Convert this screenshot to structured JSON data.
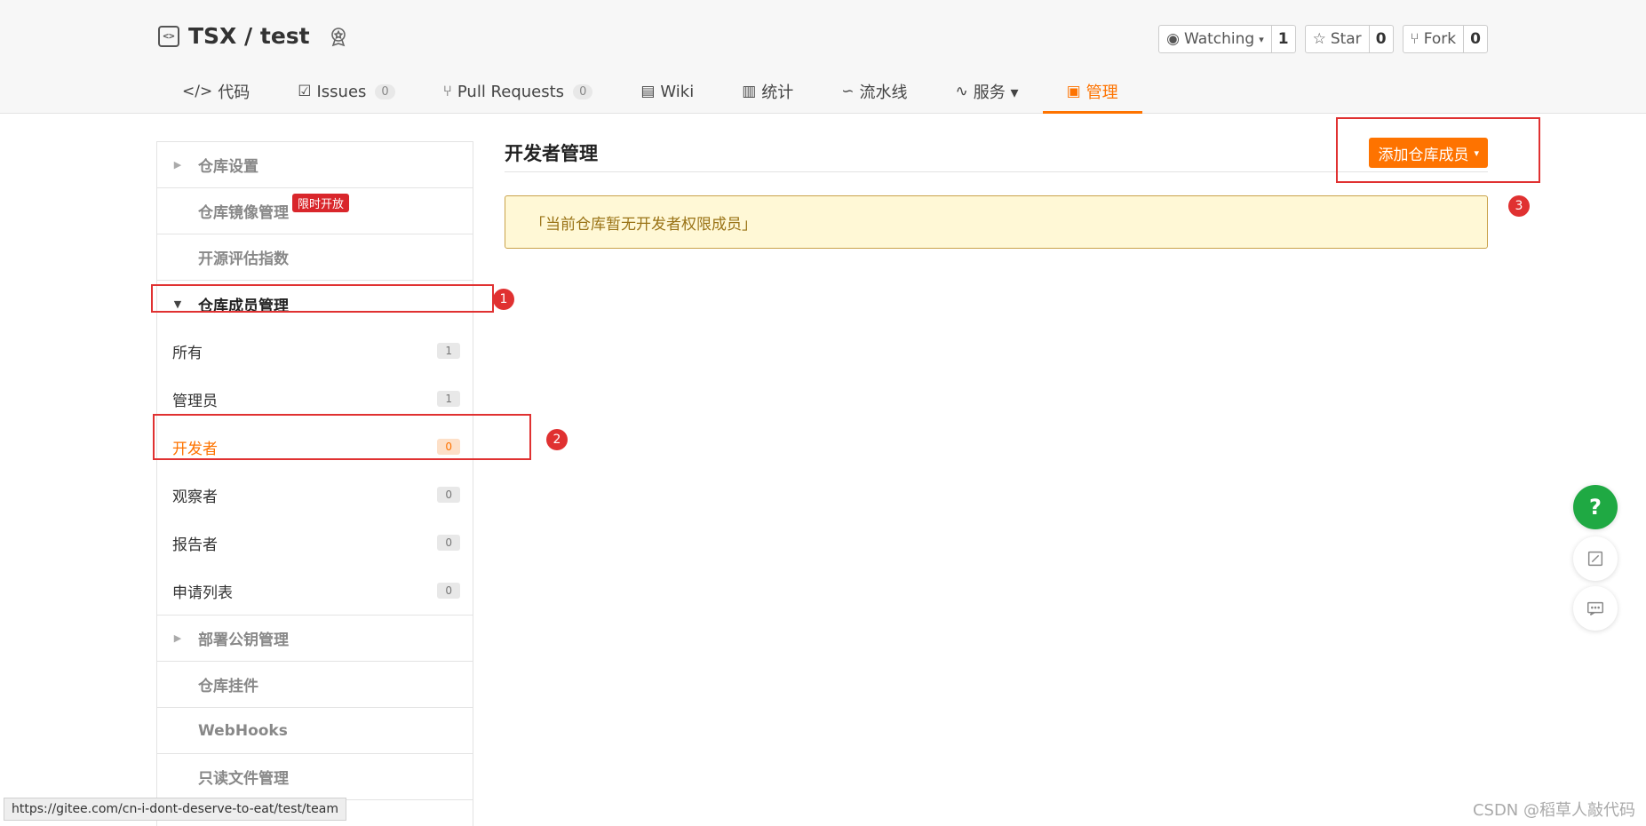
{
  "header": {
    "repo_name": "TSX / test",
    "watch": {
      "label": "Watching",
      "count": "1"
    },
    "star": {
      "label": "Star",
      "count": "0"
    },
    "fork": {
      "label": "Fork",
      "count": "0"
    }
  },
  "tabs": [
    {
      "icon": "</>",
      "label": "代码",
      "count": ""
    },
    {
      "icon": "☑",
      "label": "Issues",
      "count": "0"
    },
    {
      "icon": "⑂",
      "label": "Pull Requests",
      "count": "0"
    },
    {
      "icon": "▤",
      "label": "Wiki",
      "count": ""
    },
    {
      "icon": "▥",
      "label": "统计",
      "count": ""
    },
    {
      "icon": "∽",
      "label": "流水线",
      "count": ""
    },
    {
      "icon": "∿",
      "label": "服务 ▾",
      "count": ""
    },
    {
      "icon": "▣",
      "label": "管理",
      "count": ""
    }
  ],
  "sidebar": {
    "repo_settings": "仓库设置",
    "mirror": "仓库镜像管理",
    "mirror_tag": "限时开放",
    "oss_index": "开源评估指数",
    "members": "仓库成员管理",
    "member_items": [
      {
        "label": "所有",
        "count": "1"
      },
      {
        "label": "管理员",
        "count": "1"
      },
      {
        "label": "开发者",
        "count": "0"
      },
      {
        "label": "观察者",
        "count": "0"
      },
      {
        "label": "报告者",
        "count": "0"
      },
      {
        "label": "申请列表",
        "count": "0"
      }
    ],
    "deploy_keys": "部署公钥管理",
    "plugins": "仓库挂件",
    "webhooks": "WebHooks",
    "readonly": "只读文件管理"
  },
  "main": {
    "title": "开发者管理",
    "add_button": "添加仓库成员",
    "notice": "「当前仓库暂无开发者权限成员」"
  },
  "annotations": {
    "one": "1",
    "two": "2",
    "three": "3"
  },
  "status_url": "https://gitee.com/cn-i-dont-deserve-to-eat/test/team",
  "watermark": "CSDN @稻草人敲代码"
}
